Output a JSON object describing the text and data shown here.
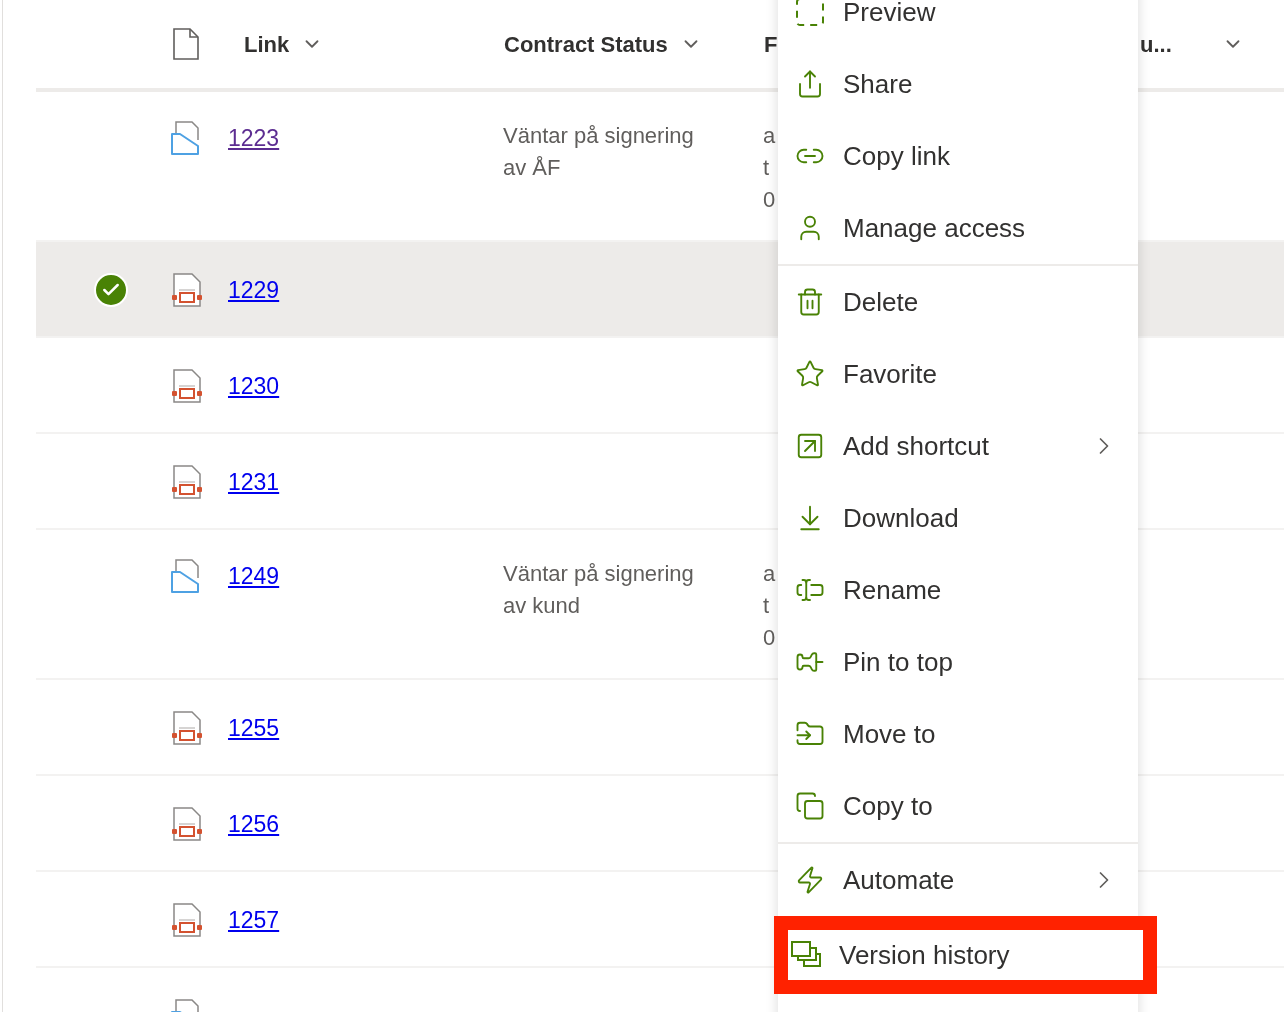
{
  "table": {
    "columns": [
      {
        "label": "Link"
      },
      {
        "label": "Contract Status"
      },
      {
        "label": "F"
      },
      {
        "label": "u..."
      }
    ],
    "rows": [
      {
        "kind": "docset",
        "link": "1223",
        "visited": true,
        "selected": false,
        "status": [
          "Väntar på signering",
          "av ÅF"
        ],
        "column_3": [
          "a",
          "t",
          "0"
        ]
      },
      {
        "kind": "slides",
        "link": "1229",
        "visited": false,
        "selected": true
      },
      {
        "kind": "slides",
        "link": "1230",
        "visited": false,
        "selected": false
      },
      {
        "kind": "slides",
        "link": "1231",
        "visited": false,
        "selected": false
      },
      {
        "kind": "docset",
        "link": "1249",
        "visited": false,
        "selected": false,
        "status": [
          "Väntar på signering",
          "av kund"
        ],
        "column_3": [
          "a",
          "t",
          "0"
        ]
      },
      {
        "kind": "slides",
        "link": "1255",
        "visited": false,
        "selected": false
      },
      {
        "kind": "slides",
        "link": "1256",
        "visited": false,
        "selected": false
      },
      {
        "kind": "slides",
        "link": "1257",
        "visited": false,
        "selected": false
      },
      {
        "kind": "docset",
        "selected": false
      }
    ]
  },
  "context_menu": {
    "items": [
      {
        "kind": "item",
        "label": "Preview",
        "has_submenu": false,
        "highlighted": false
      },
      {
        "kind": "item",
        "label": "Share",
        "has_submenu": false,
        "highlighted": false
      },
      {
        "kind": "item",
        "label": "Copy link",
        "has_submenu": false,
        "highlighted": false
      },
      {
        "kind": "item",
        "label": "Manage access",
        "has_submenu": false,
        "highlighted": false
      },
      {
        "kind": "divider"
      },
      {
        "kind": "item",
        "label": "Delete",
        "has_submenu": false,
        "highlighted": false
      },
      {
        "kind": "item",
        "label": "Favorite",
        "has_submenu": false,
        "highlighted": false
      },
      {
        "kind": "item",
        "label": "Add shortcut",
        "has_submenu": true,
        "highlighted": false
      },
      {
        "kind": "item",
        "label": "Download",
        "has_submenu": false,
        "highlighted": false
      },
      {
        "kind": "item",
        "label": "Rename",
        "has_submenu": false,
        "highlighted": false
      },
      {
        "kind": "item",
        "label": "Pin to top",
        "has_submenu": false,
        "highlighted": false
      },
      {
        "kind": "item",
        "label": "Move to",
        "has_submenu": false,
        "highlighted": false
      },
      {
        "kind": "item",
        "label": "Copy to",
        "has_submenu": false,
        "highlighted": false
      },
      {
        "kind": "divider"
      },
      {
        "kind": "item",
        "label": "Automate",
        "has_submenu": true,
        "highlighted": false
      },
      {
        "kind": "item",
        "label": "Version history",
        "has_submenu": false,
        "highlighted": true
      }
    ]
  }
}
